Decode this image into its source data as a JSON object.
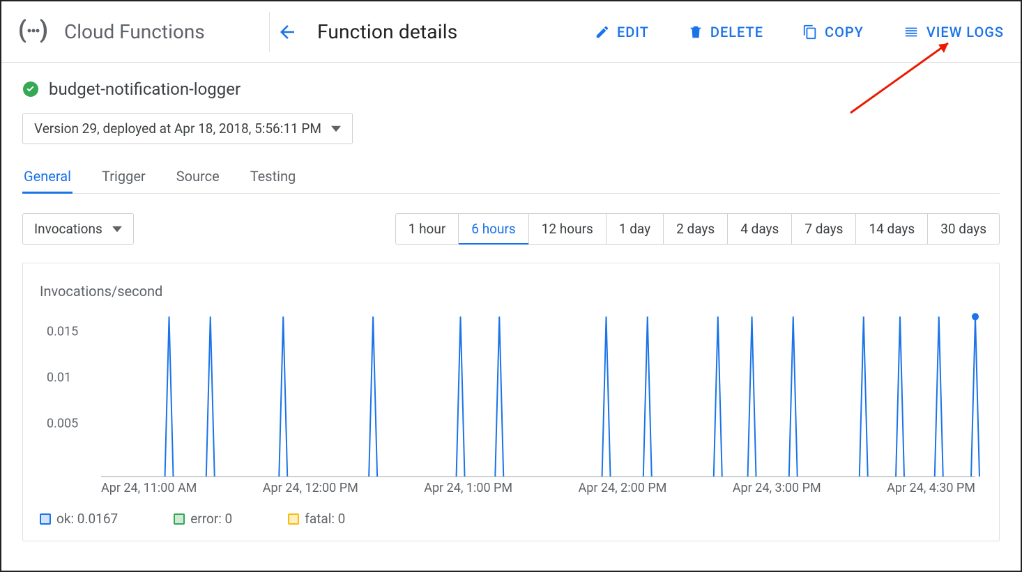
{
  "product_name": "Cloud Functions",
  "page_title": "Function details",
  "actions": {
    "edit": "EDIT",
    "delete": "DELETE",
    "copy": "COPY",
    "view_logs": "VIEW LOGS"
  },
  "function": {
    "status": "ok",
    "name": "budget-notification-logger",
    "version_label": "Version 29, deployed at Apr 18, 2018, 5:56:11 PM"
  },
  "tabs": [
    "General",
    "Trigger",
    "Source",
    "Testing"
  ],
  "active_tab": "General",
  "metric_label": "Invocations",
  "time_ranges": [
    "1 hour",
    "6 hours",
    "12 hours",
    "1 day",
    "2 days",
    "4 days",
    "7 days",
    "14 days",
    "30 days"
  ],
  "active_range": "6 hours",
  "chart": {
    "title": "Invocations/second",
    "yticks": [
      0.005,
      0.01,
      0.015
    ],
    "legend": {
      "ok": "ok: 0.0167",
      "error": "error: 0",
      "fatal": "fatal: 0"
    }
  },
  "chart_data": {
    "type": "line",
    "title": "Invocations/second",
    "ylabel": "Invocations/second",
    "ylim": [
      0,
      0.0167
    ],
    "yticks": [
      0.005,
      0.01,
      0.015
    ],
    "x_start": "Apr 24, 2018 10:30 AM",
    "x_end": "Apr 24, 2018 4:30 PM",
    "x_tick_labels": [
      "Apr 24, 11:00 AM",
      "Apr 24, 12:00 PM",
      "Apr 24, 1:00 PM",
      "Apr 24, 2:00 PM",
      "Apr 24, 3:00 PM",
      "Apr 24, 4:30 PM"
    ],
    "series": [
      {
        "name": "ok",
        "color": "#1a73e8",
        "peak_value": 0.0167,
        "baseline_value": 0,
        "peak_times": [
          "10:58",
          "11:15",
          "11:45",
          "12:22",
          "12:58",
          "01:14",
          "01:58",
          "02:15",
          "02:44",
          "02:58",
          "03:15",
          "03:44",
          "03:59",
          "04:15",
          "04:30"
        ],
        "trailing_point": {
          "time": "04:30",
          "value": 0.0167
        }
      },
      {
        "name": "error",
        "color": "#34a853",
        "values": 0
      },
      {
        "name": "fatal",
        "color": "#fbbc04",
        "values": 0
      }
    ]
  }
}
